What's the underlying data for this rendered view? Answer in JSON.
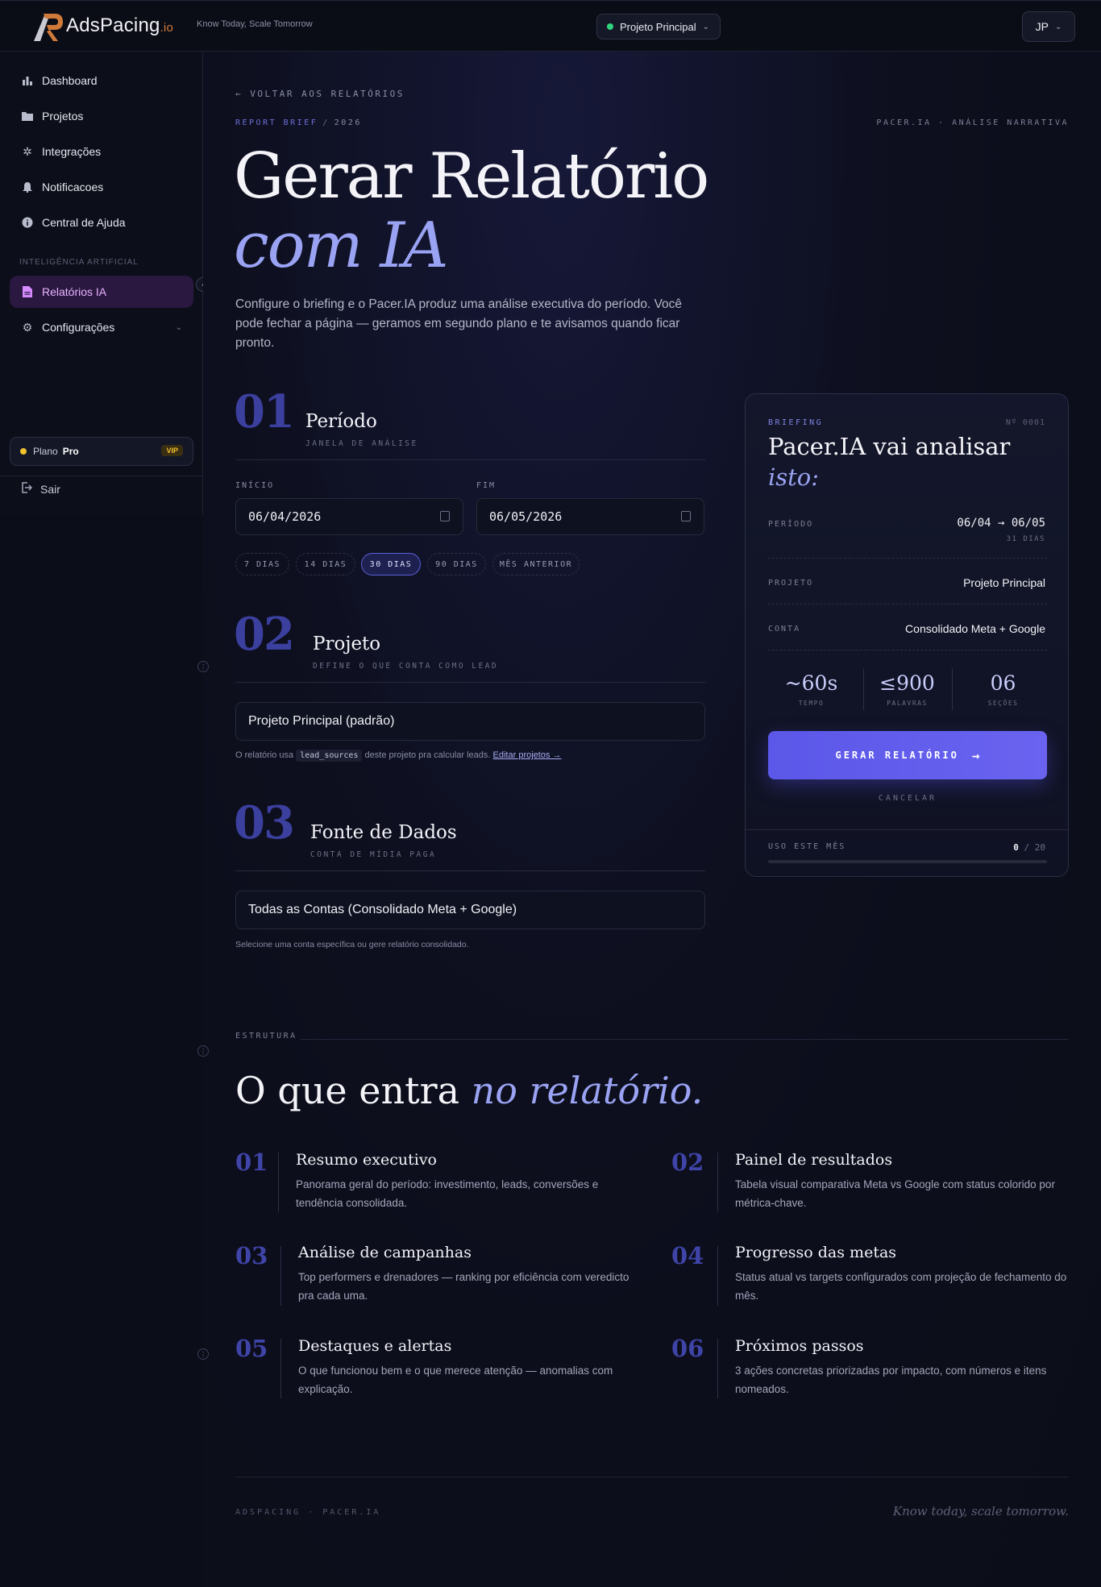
{
  "header": {
    "brand": "AdsPacing",
    "brand_suffix": ".io",
    "tagline": "Know Today, Scale Tomorrow",
    "project": "Projeto Principal",
    "user_initials": "JP"
  },
  "sidebar": {
    "items": [
      {
        "label": "Dashboard",
        "icon": "bar-chart-icon"
      },
      {
        "label": "Projetos",
        "icon": "folder-icon"
      },
      {
        "label": "Integrações",
        "icon": "gear-icon"
      },
      {
        "label": "Notificacoes",
        "icon": "bell-icon"
      },
      {
        "label": "Central de Ajuda",
        "icon": "info-icon"
      }
    ],
    "section_label": "INTELIGÊNCIA ARTIFICIAL",
    "ai_item": "Relatórios IA",
    "config_item": "Configurações",
    "plan_label": "Plano",
    "plan_name": "Pro",
    "plan_badge": "VIP",
    "logout": "Sair"
  },
  "page": {
    "back": "← VOLTAR AOS RELATÓRIOS",
    "crumb_a": "REPORT BRIEF",
    "crumb_sep": "/",
    "crumb_b": "2026",
    "right_tag": "PACER.IA · ANÁLISE NARRATIVA",
    "title_a": "Gerar Relatório",
    "title_b": "com IA",
    "lead": "Configure o briefing e o Pacer.IA produz uma análise executiva do período. Você pode fechar a página — geramos em segundo plano e te avisamos quando ficar pronto."
  },
  "period": {
    "num": "01",
    "title": "Período",
    "sub": "JANELA DE ANÁLISE",
    "start_label": "INÍCIO",
    "start_value": "06/04/2026",
    "end_label": "FIM",
    "end_value": "06/05/2026",
    "chips": [
      "7 DIAS",
      "14 DIAS",
      "30 DIAS",
      "90 DIAS",
      "MÊS ANTERIOR"
    ],
    "active_chip": "30 DIAS"
  },
  "project": {
    "num": "02",
    "title": "Projeto",
    "sub": "DEFINE O QUE CONTA COMO LEAD",
    "value": "Projeto Principal (padrão)",
    "help_a": "O relatório usa",
    "help_code": "lead_sources",
    "help_b": "deste projeto pra calcular leads.",
    "help_link": "Editar projetos →"
  },
  "source": {
    "num": "03",
    "title": "Fonte de Dados",
    "sub": "CONTA DE MÍDIA PAGA",
    "value": "Todas as Contas (Consolidado Meta + Google)",
    "help": "Selecione uma conta específica ou gere relatório consolidado."
  },
  "brief": {
    "label": "BRIEFING",
    "number": "Nº 0001",
    "title_a": "Pacer.IA vai analisar",
    "title_b": "isto:",
    "period_k": "PERÍODO",
    "period_v": "06/04 → 06/05",
    "period_sub": "31 DIAS",
    "project_k": "PROJETO",
    "project_v": "Projeto Principal",
    "account_k": "CONTA",
    "account_v": "Consolidado Meta + Google",
    "stats": [
      {
        "value": "~60s",
        "label": "TEMPO"
      },
      {
        "value": "≤900",
        "label": "PALAVRAS"
      },
      {
        "value": "06",
        "label": "SEÇÕES"
      }
    ],
    "button": "GERAR RELATÓRIO",
    "button_arrow": "→",
    "cancel": "CANCELAR",
    "usage_k": "USO ESTE MÊS",
    "usage_used": "0",
    "usage_total": "/ 20",
    "usage_fraction": 0
  },
  "structure": {
    "label": "ESTRUTURA",
    "title_a": "O que entra",
    "title_b": "no relatório.",
    "items": [
      {
        "num": "01",
        "title": "Resumo executivo",
        "desc": "Panorama geral do período: investimento, leads, conversões e tendência consolidada."
      },
      {
        "num": "02",
        "title": "Painel de resultados",
        "desc": "Tabela visual comparativa Meta vs Google com status colorido por métrica-chave."
      },
      {
        "num": "03",
        "title": "Análise de campanhas",
        "desc": "Top performers e drenadores — ranking por eficiência com veredicto pra cada uma."
      },
      {
        "num": "04",
        "title": "Progresso das metas",
        "desc": "Status atual vs targets configurados com projeção de fechamento do mês."
      },
      {
        "num": "05",
        "title": "Destaques e alertas",
        "desc": "O que funcionou bem e o que merece atenção — anomalias com explicação."
      },
      {
        "num": "06",
        "title": "Próximos passos",
        "desc": "3 ações concretas priorizadas por impacto, com números e itens nomeados."
      }
    ]
  },
  "footer": {
    "left": "ADSPACING · PACER.IA",
    "right": "Know today, scale tomorrow."
  }
}
